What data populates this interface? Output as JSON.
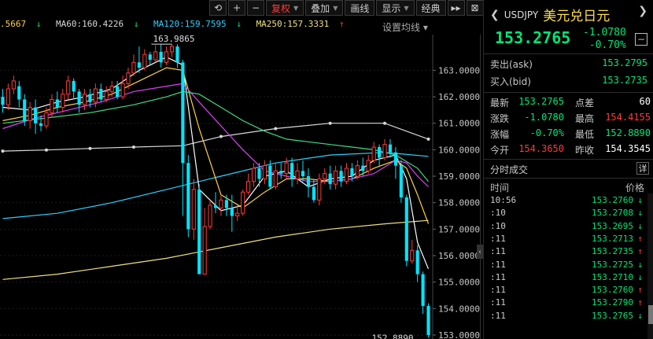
{
  "toolbar": {
    "buttons": [
      {
        "id": "refresh",
        "icon": "refresh-icon",
        "glyph": "⟲"
      },
      {
        "id": "zoom-in",
        "icon": "plus-icon",
        "glyph": "+"
      },
      {
        "id": "zoom-out",
        "icon": "minus-icon",
        "glyph": "−"
      }
    ],
    "fuquan": "复权",
    "diejia": "叠加",
    "huaxian": "画线",
    "xianshi": "显示",
    "jingdian": "经典",
    "ff": "▸▸",
    "exit": "⊠"
  },
  "legend": [
    {
      "text": ".5667",
      "arrow": "↓",
      "color": "#ffd23f"
    },
    {
      "text": "MA60:160.4226",
      "arrow": "↓",
      "color": "#d8d8d8"
    },
    {
      "text": "MA120:159.7595",
      "arrow": "↓",
      "color": "#2fd0ff"
    },
    {
      "text": "MA250:157.3331",
      "arrow": "↑",
      "color": "#f0e080"
    }
  ],
  "legend_settings": "设置均线 ▾",
  "chart_data": {
    "type": "candlestick",
    "y_ticks": [
      "163.0000",
      "162.0000",
      "161.0000",
      "160.0000",
      "159.0000",
      "158.0000",
      "157.0000",
      "156.0000",
      "155.0000",
      "154.0000",
      "153.0000"
    ],
    "ylim": [
      152.85,
      164.35
    ],
    "annotations": {
      "high": "163.9865",
      "low": "152.8890"
    },
    "candles": [
      [
        162.0,
        161.7,
        162.3,
        161.4
      ],
      [
        161.7,
        162.3,
        162.5,
        161.5
      ],
      [
        162.3,
        162.6,
        162.8,
        162.1
      ],
      [
        162.4,
        161.9,
        162.6,
        161.6
      ],
      [
        161.9,
        161.1,
        162.1,
        160.9
      ],
      [
        161.1,
        161.6,
        161.8,
        160.8
      ],
      [
        161.6,
        161.0,
        161.9,
        160.6
      ],
      [
        161.0,
        160.9,
        161.3,
        160.7
      ],
      [
        160.9,
        161.4,
        161.6,
        160.8
      ],
      [
        161.4,
        161.9,
        162.1,
        161.2
      ],
      [
        161.9,
        161.6,
        162.2,
        161.4
      ],
      [
        161.6,
        162.1,
        162.3,
        161.4
      ],
      [
        162.1,
        162.6,
        162.8,
        161.9
      ],
      [
        162.6,
        162.2,
        162.7,
        161.9
      ],
      [
        162.2,
        161.7,
        162.3,
        161.4
      ],
      [
        161.7,
        162.1,
        162.3,
        161.5
      ],
      [
        162.1,
        161.8,
        162.3,
        161.6
      ],
      [
        161.8,
        162.3,
        162.5,
        161.6
      ],
      [
        162.3,
        161.9,
        162.5,
        161.8
      ],
      [
        161.9,
        162.2,
        162.4,
        161.8
      ],
      [
        162.2,
        162.4,
        162.6,
        162.0
      ],
      [
        162.4,
        162.0,
        162.6,
        161.9
      ],
      [
        162.0,
        162.5,
        162.8,
        161.9
      ],
      [
        162.5,
        162.9,
        163.1,
        162.3
      ],
      [
        162.9,
        163.3,
        163.6,
        162.8
      ],
      [
        163.3,
        163.1,
        163.9,
        162.9
      ],
      [
        163.1,
        163.6,
        163.8,
        163.0
      ],
      [
        163.6,
        163.4,
        163.7,
        163.2
      ],
      [
        163.4,
        163.7,
        163.95,
        163.3
      ],
      [
        163.7,
        163.3,
        163.98,
        163.1
      ],
      [
        163.3,
        163.7,
        163.9,
        163.2
      ],
      [
        163.7,
        163.9,
        163.99,
        163.5
      ],
      [
        163.9,
        163.3,
        163.99,
        163.1
      ],
      [
        163.3,
        159.5,
        163.4,
        157.5
      ],
      [
        159.5,
        157.0,
        159.8,
        156.7
      ],
      [
        157.0,
        158.5,
        158.9,
        156.6
      ],
      [
        158.5,
        155.3,
        158.7,
        155.3
      ],
      [
        155.3,
        157.1,
        157.8,
        155.8
      ],
      [
        157.1,
        157.9,
        158.1,
        157.0
      ],
      [
        157.9,
        157.8,
        158.4,
        157.6
      ],
      [
        157.8,
        158.1,
        158.3,
        157.5
      ],
      [
        158.1,
        157.8,
        158.3,
        157.5
      ],
      [
        157.8,
        157.5,
        158.3,
        156.9
      ],
      [
        157.5,
        157.6,
        157.9,
        157.3
      ],
      [
        157.6,
        158.4,
        158.5,
        157.5
      ],
      [
        158.4,
        158.8,
        159.1,
        158.3
      ],
      [
        158.8,
        159.3,
        159.5,
        158.6
      ],
      [
        159.3,
        158.9,
        159.5,
        158.6
      ],
      [
        158.9,
        159.4,
        159.6,
        158.7
      ],
      [
        159.4,
        158.6,
        159.6,
        158.5
      ],
      [
        158.6,
        159.2,
        159.5,
        158.5
      ],
      [
        159.2,
        159.1,
        159.5,
        158.9
      ],
      [
        159.1,
        159.5,
        159.7,
        158.9
      ],
      [
        159.5,
        158.9,
        159.7,
        158.6
      ],
      [
        158.9,
        159.2,
        159.5,
        158.7
      ],
      [
        159.2,
        159.0,
        159.6,
        158.8
      ],
      [
        159.0,
        158.6,
        159.3,
        158.2
      ],
      [
        158.6,
        158.1,
        158.9,
        158.0
      ],
      [
        158.1,
        158.9,
        159.1,
        157.9
      ],
      [
        158.9,
        159.1,
        159.3,
        158.7
      ],
      [
        159.1,
        158.7,
        159.4,
        158.5
      ],
      [
        158.7,
        159.2,
        159.4,
        158.5
      ],
      [
        159.2,
        158.8,
        159.4,
        158.6
      ],
      [
        158.8,
        159.3,
        159.5,
        158.7
      ],
      [
        159.3,
        159.0,
        159.5,
        158.8
      ],
      [
        159.0,
        159.4,
        159.6,
        158.9
      ],
      [
        159.4,
        159.2,
        159.7,
        159.0
      ],
      [
        159.2,
        159.6,
        159.8,
        159.1
      ],
      [
        159.6,
        160.1,
        160.3,
        159.5
      ],
      [
        160.1,
        159.7,
        160.2,
        159.4
      ],
      [
        159.7,
        160.2,
        160.4,
        159.6
      ],
      [
        160.2,
        159.9,
        160.4,
        159.7
      ],
      [
        159.9,
        159.4,
        160.1,
        158.9
      ],
      [
        159.4,
        158.2,
        159.6,
        158.0
      ],
      [
        158.2,
        155.8,
        158.3,
        155.6
      ],
      [
        155.8,
        156.2,
        156.6,
        155.7
      ],
      [
        156.2,
        155.3,
        156.4,
        155.0
      ],
      [
        155.3,
        154.1,
        155.4,
        153.8
      ],
      [
        154.1,
        153.0,
        154.2,
        152.9
      ]
    ],
    "ma": [
      {
        "name": "MA60",
        "color": "#d8d8d8",
        "dots": true,
        "points": [
          [
            0,
            159.95
          ],
          [
            8,
            159.99
          ],
          [
            16,
            160.05
          ],
          [
            24,
            160.1
          ],
          [
            33,
            160.15
          ],
          [
            40,
            160.5
          ],
          [
            50,
            160.8
          ],
          [
            60,
            161.0
          ],
          [
            70,
            161.0
          ],
          [
            78,
            160.4
          ]
        ]
      },
      {
        "name": "MA120",
        "color": "#2fd0ff",
        "points": [
          [
            0,
            157.4
          ],
          [
            10,
            157.6
          ],
          [
            20,
            158.0
          ],
          [
            30,
            158.5
          ],
          [
            40,
            159.0
          ],
          [
            50,
            159.5
          ],
          [
            60,
            159.8
          ],
          [
            70,
            159.9
          ],
          [
            78,
            159.75
          ]
        ]
      },
      {
        "name": "MA250",
        "color": "#f0e080",
        "points": [
          [
            0,
            155.1
          ],
          [
            10,
            155.3
          ],
          [
            20,
            155.6
          ],
          [
            30,
            155.9
          ],
          [
            40,
            156.3
          ],
          [
            50,
            156.7
          ],
          [
            60,
            157.0
          ],
          [
            70,
            157.2
          ],
          [
            78,
            157.33
          ]
        ]
      },
      {
        "name": "MA5",
        "color": "#ffffff",
        "points": [
          [
            0,
            161.6
          ],
          [
            5,
            161.5
          ],
          [
            10,
            161.8
          ],
          [
            15,
            162.0
          ],
          [
            20,
            162.3
          ],
          [
            25,
            163.0
          ],
          [
            30,
            163.5
          ],
          [
            33,
            163.2
          ],
          [
            36,
            158.5
          ],
          [
            40,
            157.7
          ],
          [
            44,
            157.9
          ],
          [
            48,
            159.0
          ],
          [
            52,
            159.2
          ],
          [
            56,
            158.6
          ],
          [
            60,
            158.9
          ],
          [
            64,
            159.0
          ],
          [
            68,
            159.6
          ],
          [
            72,
            159.8
          ],
          [
            74,
            158.9
          ],
          [
            76,
            156.5
          ],
          [
            78,
            155.5
          ]
        ]
      },
      {
        "name": "MA10",
        "color": "#ffd23f",
        "points": [
          [
            0,
            161.1
          ],
          [
            5,
            161.3
          ],
          [
            10,
            161.6
          ],
          [
            15,
            161.8
          ],
          [
            20,
            162.1
          ],
          [
            25,
            162.6
          ],
          [
            30,
            163.1
          ],
          [
            33,
            163.0
          ],
          [
            36,
            160.8
          ],
          [
            40,
            158.3
          ],
          [
            44,
            157.8
          ],
          [
            48,
            158.4
          ],
          [
            52,
            158.9
          ],
          [
            56,
            158.9
          ],
          [
            60,
            158.8
          ],
          [
            64,
            158.9
          ],
          [
            68,
            159.3
          ],
          [
            72,
            159.6
          ],
          [
            74,
            159.3
          ],
          [
            76,
            158.3
          ],
          [
            78,
            157.2
          ]
        ]
      },
      {
        "name": "MA20",
        "color": "#e040fb",
        "points": [
          [
            0,
            160.8
          ],
          [
            6,
            161.2
          ],
          [
            12,
            161.5
          ],
          [
            18,
            161.8
          ],
          [
            24,
            162.2
          ],
          [
            30,
            162.4
          ],
          [
            33,
            162.5
          ],
          [
            36,
            161.8
          ],
          [
            40,
            160.9
          ],
          [
            44,
            160.0
          ],
          [
            48,
            159.2
          ],
          [
            52,
            159.0
          ],
          [
            56,
            158.8
          ],
          [
            60,
            158.8
          ],
          [
            64,
            158.9
          ],
          [
            68,
            159.1
          ],
          [
            72,
            159.6
          ],
          [
            74,
            159.5
          ],
          [
            76,
            159.0
          ],
          [
            78,
            158.6
          ]
        ]
      },
      {
        "name": "MA30",
        "color": "#3ddc84",
        "points": [
          [
            0,
            161.0
          ],
          [
            8,
            161.2
          ],
          [
            16,
            161.4
          ],
          [
            24,
            161.7
          ],
          [
            30,
            162.0
          ],
          [
            33,
            162.2
          ],
          [
            36,
            162.1
          ],
          [
            40,
            161.6
          ],
          [
            44,
            161.1
          ],
          [
            48,
            160.7
          ],
          [
            52,
            160.4
          ],
          [
            56,
            160.3
          ],
          [
            60,
            160.2
          ],
          [
            64,
            160.1
          ],
          [
            68,
            160.0
          ],
          [
            72,
            159.8
          ],
          [
            76,
            159.3
          ],
          [
            78,
            158.8
          ]
        ]
      }
    ]
  },
  "panel": {
    "code": "USDJPY",
    "name": "美元兑日元",
    "price": "153.2765",
    "change": "-1.0780",
    "change_pct": "-0.70%",
    "minus": "−",
    "ask": {
      "label": "卖出(ask)",
      "value": "153.2795"
    },
    "bid": {
      "label": "买入(bid)",
      "value": "153.2735"
    },
    "stats": [
      [
        {
          "l": "最新",
          "v": "153.2765",
          "c": "#00e676"
        },
        {
          "l": "点差",
          "v": "60",
          "c": "#ffffff"
        }
      ],
      [
        {
          "l": "涨跌",
          "v": "-1.0780",
          "c": "#00e676"
        },
        {
          "l": "最高",
          "v": "154.4155",
          "c": "#ff3b3b"
        }
      ],
      [
        {
          "l": "涨幅",
          "v": "-0.70%",
          "c": "#00e676"
        },
        {
          "l": "最低",
          "v": "152.8890",
          "c": "#00e676"
        }
      ],
      [
        {
          "l": "今开",
          "v": "154.3650",
          "c": "#ff3b3b"
        },
        {
          "l": "昨收",
          "v": "154.3545",
          "c": "#ffffff"
        }
      ]
    ],
    "ticks_title": "分时成交",
    "ticks_detail": "详",
    "tick_head": {
      "time": "时间",
      "price": "价格"
    },
    "ticks": [
      {
        "t": "10:56",
        "p": "153.2760",
        "a": "↓",
        "up": false
      },
      {
        "t": ":10",
        "p": "153.2708",
        "a": "↓",
        "up": false
      },
      {
        "t": ":10",
        "p": "153.2695",
        "a": "↓",
        "up": false
      },
      {
        "t": ":11",
        "p": "153.2713",
        "a": "↑",
        "up": true
      },
      {
        "t": ":11",
        "p": "153.2735",
        "a": "↑",
        "up": true
      },
      {
        "t": ":11",
        "p": "153.2725",
        "a": "↓",
        "up": false
      },
      {
        "t": ":11",
        "p": "153.2710",
        "a": "↓",
        "up": false
      },
      {
        "t": ":11",
        "p": "153.2760",
        "a": "↑",
        "up": true
      },
      {
        "t": ":11",
        "p": "153.2790",
        "a": "↑",
        "up": true
      },
      {
        "t": ":11",
        "p": "153.2765",
        "a": "↓",
        "up": false
      }
    ]
  }
}
